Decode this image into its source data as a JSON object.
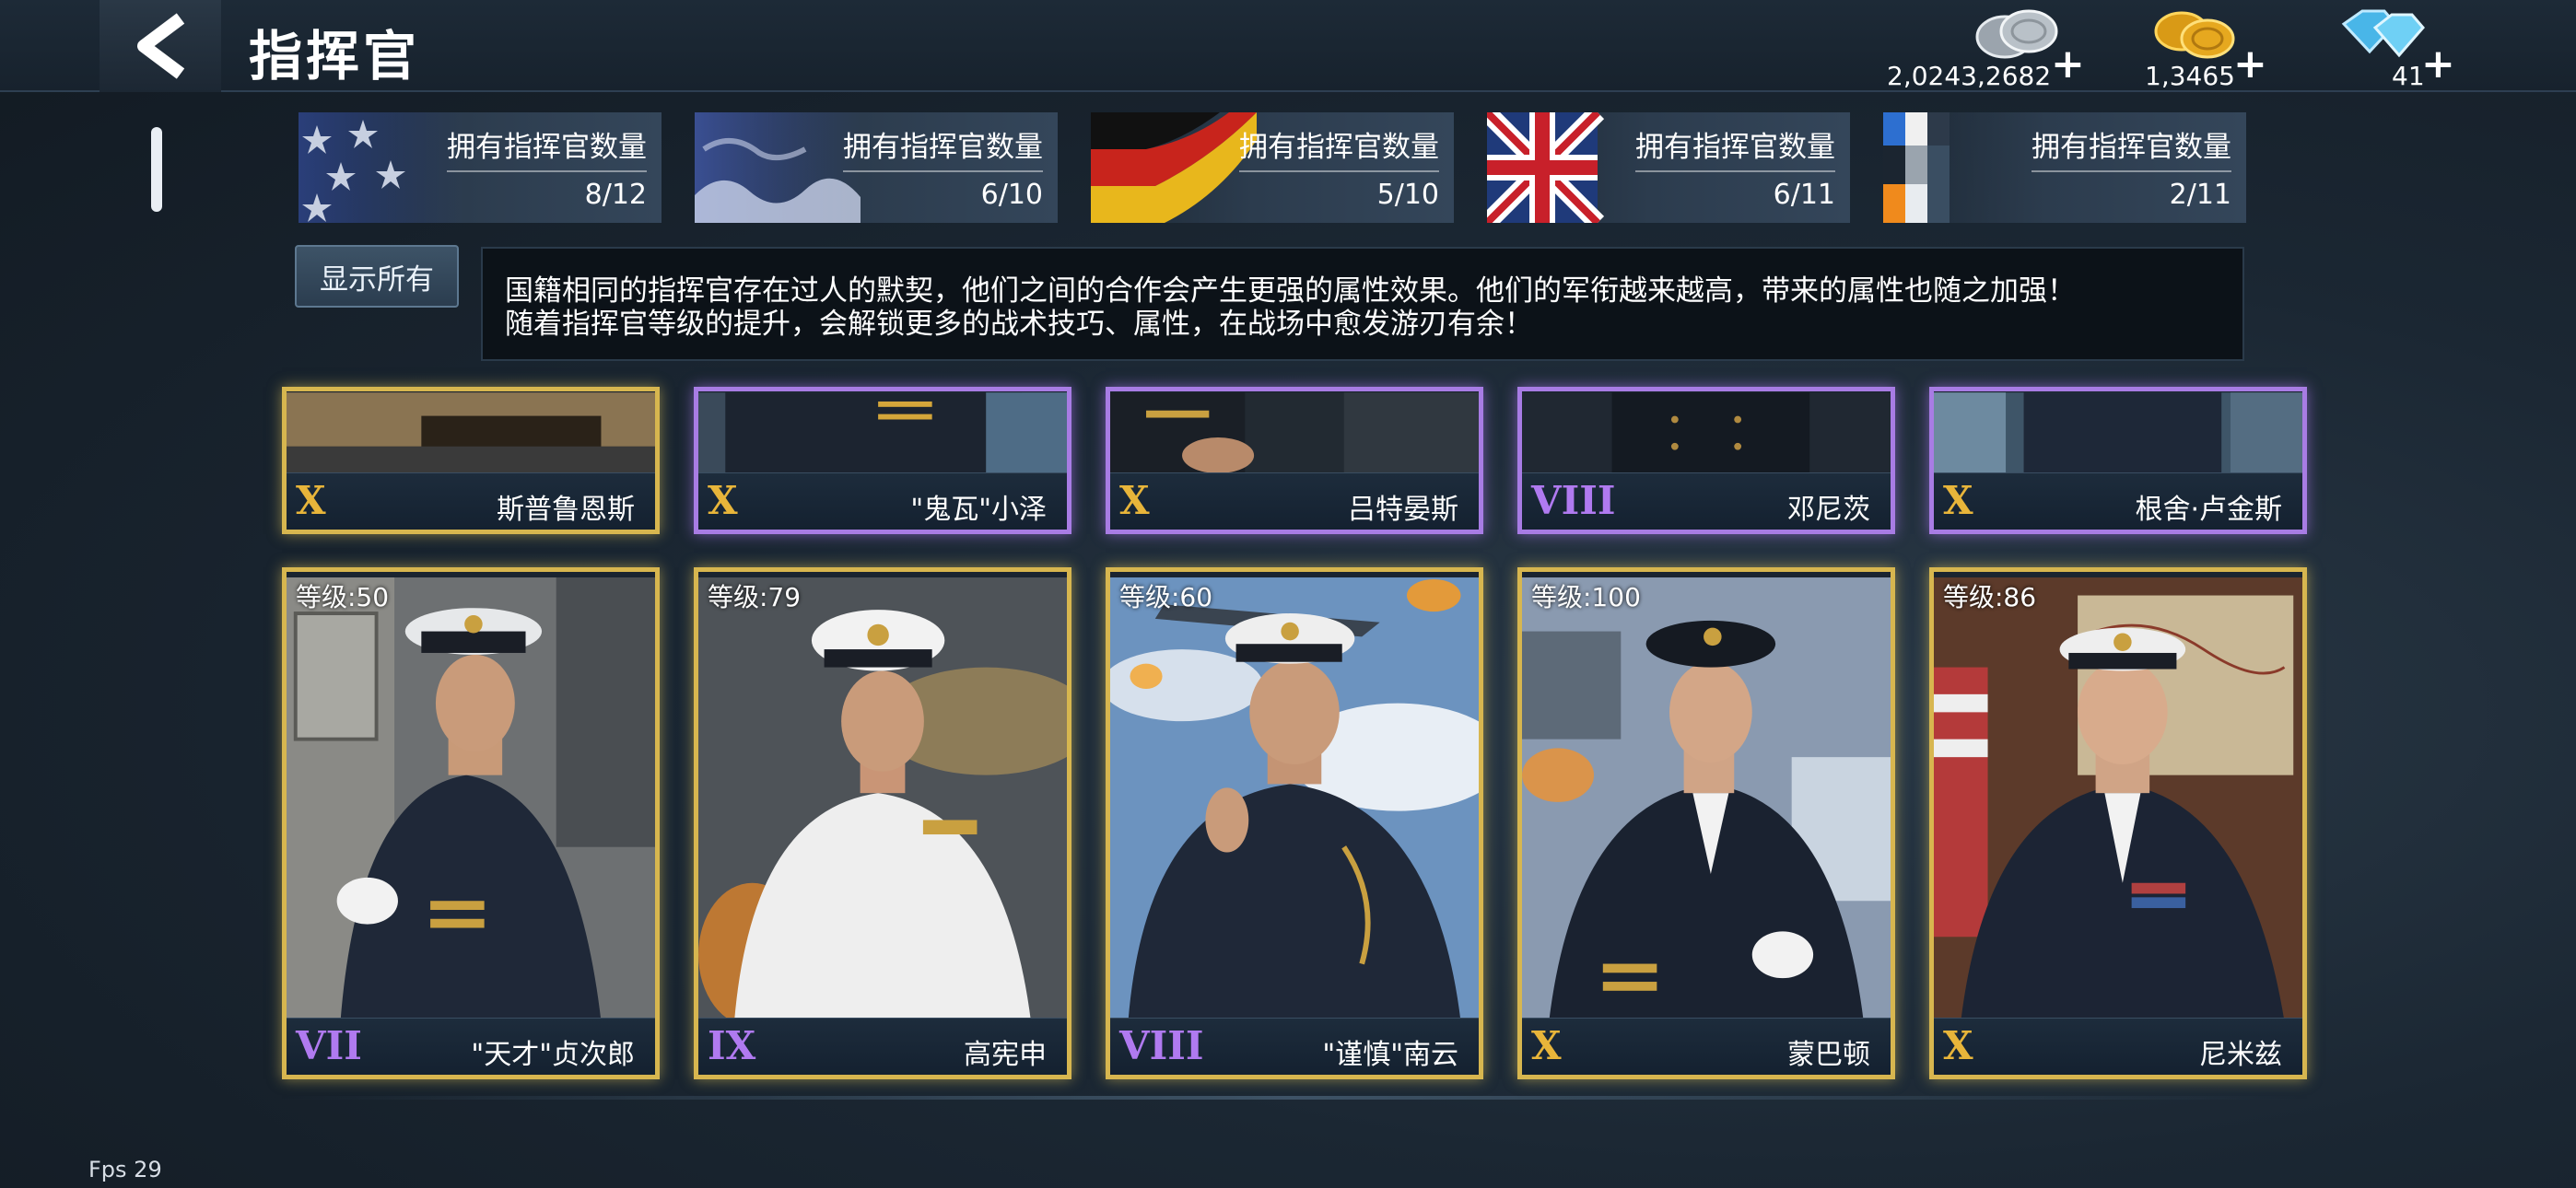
{
  "header": {
    "title": "指挥官",
    "currencies": [
      {
        "icon": "silver-coin-icon",
        "amount": "2,0243,2682",
        "plus": "+"
      },
      {
        "icon": "gold-coin-icon",
        "amount": "1,3465",
        "plus": "+"
      },
      {
        "icon": "diamond-icon",
        "amount": "41",
        "plus": "+"
      }
    ]
  },
  "nations": [
    {
      "flag": "usa-flag",
      "label": "拥有指挥官数量",
      "count": "8/12"
    },
    {
      "flag": "japan-flag",
      "label": "拥有指挥官数量",
      "count": "6/10"
    },
    {
      "flag": "germany-flag",
      "label": "拥有指挥官数量",
      "count": "5/10"
    },
    {
      "flag": "uk-flag",
      "label": "拥有指挥官数量",
      "count": "6/11"
    },
    {
      "flag": "other-flag",
      "label": "拥有指挥官数量",
      "count": "2/11"
    }
  ],
  "show_all_label": "显示所有",
  "info": {
    "line1": "国籍相同的指挥官存在过人的默契，他们之间的合作会产生更强的属性效果。他们的军衔越来越高，带来的属性也随之加强！",
    "line2": "随着指挥官等级的提升，会解锁更多的战术技巧、属性，在战场中愈发游刃有余！"
  },
  "top_row_cards": [
    {
      "rank": "X",
      "rank_color": "gold",
      "name": "斯普鲁恩斯"
    },
    {
      "rank": "X",
      "rank_color": "gold",
      "name": "\"鬼瓦\"小泽"
    },
    {
      "rank": "X",
      "rank_color": "gold",
      "name": "吕特晏斯"
    },
    {
      "rank": "VIII",
      "rank_color": "violet",
      "name": "邓尼茨"
    },
    {
      "rank": "X",
      "rank_color": "gold",
      "name": "根舍·卢金斯"
    }
  ],
  "bottom_row_cards": [
    {
      "level": "等级:50",
      "rank": "VII",
      "rank_color": "violet",
      "name": "\"天才\"贞次郎"
    },
    {
      "level": "等级:79",
      "rank": "IX",
      "rank_color": "violet",
      "name": "高宪申"
    },
    {
      "level": "等级:60",
      "rank": "VIII",
      "rank_color": "violet",
      "name": "\"谨慎\"南云"
    },
    {
      "level": "等级:100",
      "rank": "X",
      "rank_color": "gold",
      "name": "蒙巴顿"
    },
    {
      "level": "等级:86",
      "rank": "X",
      "rank_color": "gold",
      "name": "尼米兹"
    }
  ],
  "fps": "Fps 29"
}
